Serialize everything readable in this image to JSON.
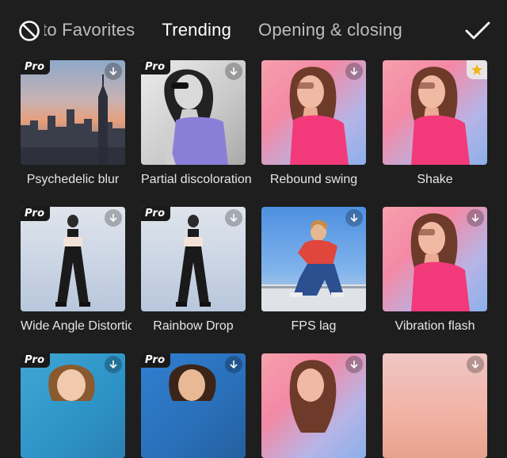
{
  "header": {
    "tabs": [
      {
        "label": "Add to Favorites",
        "active": false
      },
      {
        "label": "Trending",
        "active": true
      },
      {
        "label": "Opening & closing",
        "active": false
      }
    ]
  },
  "icons": {
    "cancel": "prohibited-circle-icon",
    "confirm": "check-icon",
    "download": "download-arrow-icon",
    "favorite": "star-icon"
  },
  "effects": [
    {
      "label": "Psychedelic blur",
      "pro": true,
      "badge": "Pro",
      "status": "download"
    },
    {
      "label": "Partial discoloration",
      "pro": true,
      "badge": "Pro",
      "status": "download"
    },
    {
      "label": "Rebound swing",
      "pro": false,
      "badge": "",
      "status": "download"
    },
    {
      "label": "Shake",
      "pro": false,
      "badge": "",
      "status": "favorite"
    },
    {
      "label": "Wide Angle Distortion",
      "pro": true,
      "badge": "Pro",
      "status": "download"
    },
    {
      "label": "Rainbow Drop",
      "pro": true,
      "badge": "Pro",
      "status": "download"
    },
    {
      "label": "FPS lag",
      "pro": false,
      "badge": "",
      "status": "download"
    },
    {
      "label": "Vibration flash",
      "pro": false,
      "badge": "",
      "status": "download"
    },
    {
      "label": "",
      "pro": true,
      "badge": "Pro",
      "status": "download"
    },
    {
      "label": "",
      "pro": true,
      "badge": "Pro",
      "status": "download"
    },
    {
      "label": "",
      "pro": false,
      "badge": "",
      "status": "download"
    },
    {
      "label": "",
      "pro": false,
      "badge": "",
      "status": "download"
    }
  ],
  "colors": {
    "background": "#1e1e1e",
    "active_tab": "#ffffff",
    "inactive_tab": "#bdbdbd",
    "star": "#f2b51b"
  }
}
